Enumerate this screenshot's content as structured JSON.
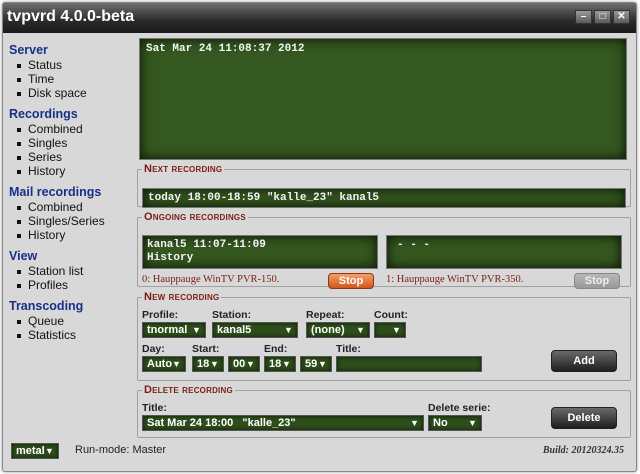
{
  "window": {
    "title": "tvpvrd 4.0.0-beta",
    "controls": [
      "–",
      "□",
      "✕"
    ]
  },
  "sidebar": {
    "sections": [
      {
        "heading": "Server",
        "items": [
          "Status",
          "Time",
          "Disk space"
        ]
      },
      {
        "heading": "Recordings",
        "items": [
          "Combined",
          "Singles",
          "Series",
          "History"
        ]
      },
      {
        "heading": "Mail recordings",
        "items": [
          "Combined",
          "Singles/Series",
          "History"
        ]
      },
      {
        "heading": "View",
        "items": [
          "Station list",
          "Profiles"
        ]
      },
      {
        "heading": "Transcoding",
        "items": [
          "Queue",
          "Statistics"
        ]
      }
    ]
  },
  "display": {
    "text": "Sat Mar 24 11:08:37 2012"
  },
  "next_recording": {
    "legend": "Next recording",
    "text": "today 18:00-18:59 \"kalle_23\" kanal5"
  },
  "ongoing": {
    "legend": "Ongoing recordings",
    "tuner0": {
      "line1": "kanal5 11:07-11:09",
      "line2": "History",
      "label": "0: Hauppauge WinTV PVR-150.",
      "stop_label": "Stop"
    },
    "tuner1": {
      "line1": "- - -",
      "label": "1: Hauppauge WinTV PVR-350.",
      "stop_label": "Stop"
    }
  },
  "new_recording": {
    "legend": "New recording",
    "profile_label": "Profile:",
    "profile_value": "tnormal",
    "station_label": "Station:",
    "station_value": "kanal5",
    "repeat_label": "Repeat:",
    "repeat_value": "(none)",
    "count_label": "Count:",
    "count_value": "",
    "day_label": "Day:",
    "day_value": "Auto",
    "start_label": "Start:",
    "start_hour": "18",
    "start_min": "00",
    "end_label": "End:",
    "end_hour": "18",
    "end_min": "59",
    "title_label": "Title:",
    "title_value": "",
    "add_label": "Add"
  },
  "delete_recording": {
    "legend": "Delete recording",
    "title_label": "Title:",
    "title_value": "Sat Mar 24 18:00   \"kalle_23\"",
    "serie_label": "Delete serie:",
    "serie_value": "No",
    "delete_label": "Delete"
  },
  "footer": {
    "theme_value": "metal",
    "run_mode": "Run-mode: Master",
    "build": "Build: 20120324.35"
  }
}
